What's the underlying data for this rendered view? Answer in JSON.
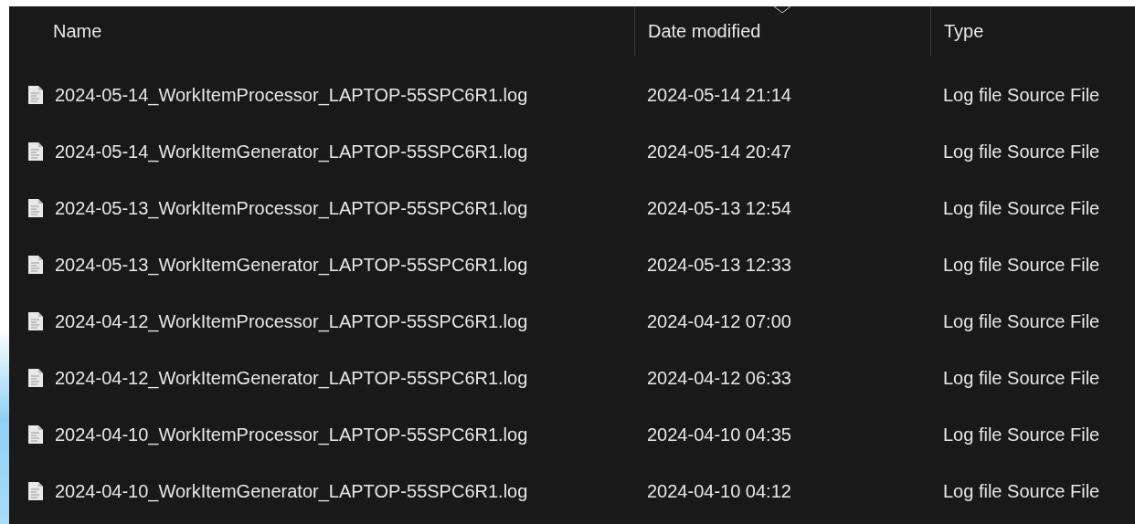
{
  "table": {
    "columns": [
      {
        "label": "Name",
        "sorted": false
      },
      {
        "label": "Date modified",
        "sorted": true
      },
      {
        "label": "Type",
        "sorted": false
      }
    ],
    "rows": [
      {
        "name": "2024-05-14_WorkItemProcessor_LAPTOP-55SPC6R1.log",
        "date": "2024-05-14 21:14",
        "type": "Log file Source File"
      },
      {
        "name": "2024-05-14_WorkItemGenerator_LAPTOP-55SPC6R1.log",
        "date": "2024-05-14 20:47",
        "type": "Log file Source File"
      },
      {
        "name": "2024-05-13_WorkItemProcessor_LAPTOP-55SPC6R1.log",
        "date": "2024-05-13 12:54",
        "type": "Log file Source File"
      },
      {
        "name": "2024-05-13_WorkItemGenerator_LAPTOP-55SPC6R1.log",
        "date": "2024-05-13 12:33",
        "type": "Log file Source File"
      },
      {
        "name": "2024-04-12_WorkItemProcessor_LAPTOP-55SPC6R1.log",
        "date": "2024-04-12 07:00",
        "type": "Log file Source File"
      },
      {
        "name": "2024-04-12_WorkItemGenerator_LAPTOP-55SPC6R1.log",
        "date": "2024-04-12 06:33",
        "type": "Log file Source File"
      },
      {
        "name": "2024-04-10_WorkItemProcessor_LAPTOP-55SPC6R1.log",
        "date": "2024-04-10 04:35",
        "type": "Log file Source File"
      },
      {
        "name": "2024-04-10_WorkItemGenerator_LAPTOP-55SPC6R1.log",
        "date": "2024-04-10 04:12",
        "type": "Log file Source File"
      }
    ]
  }
}
